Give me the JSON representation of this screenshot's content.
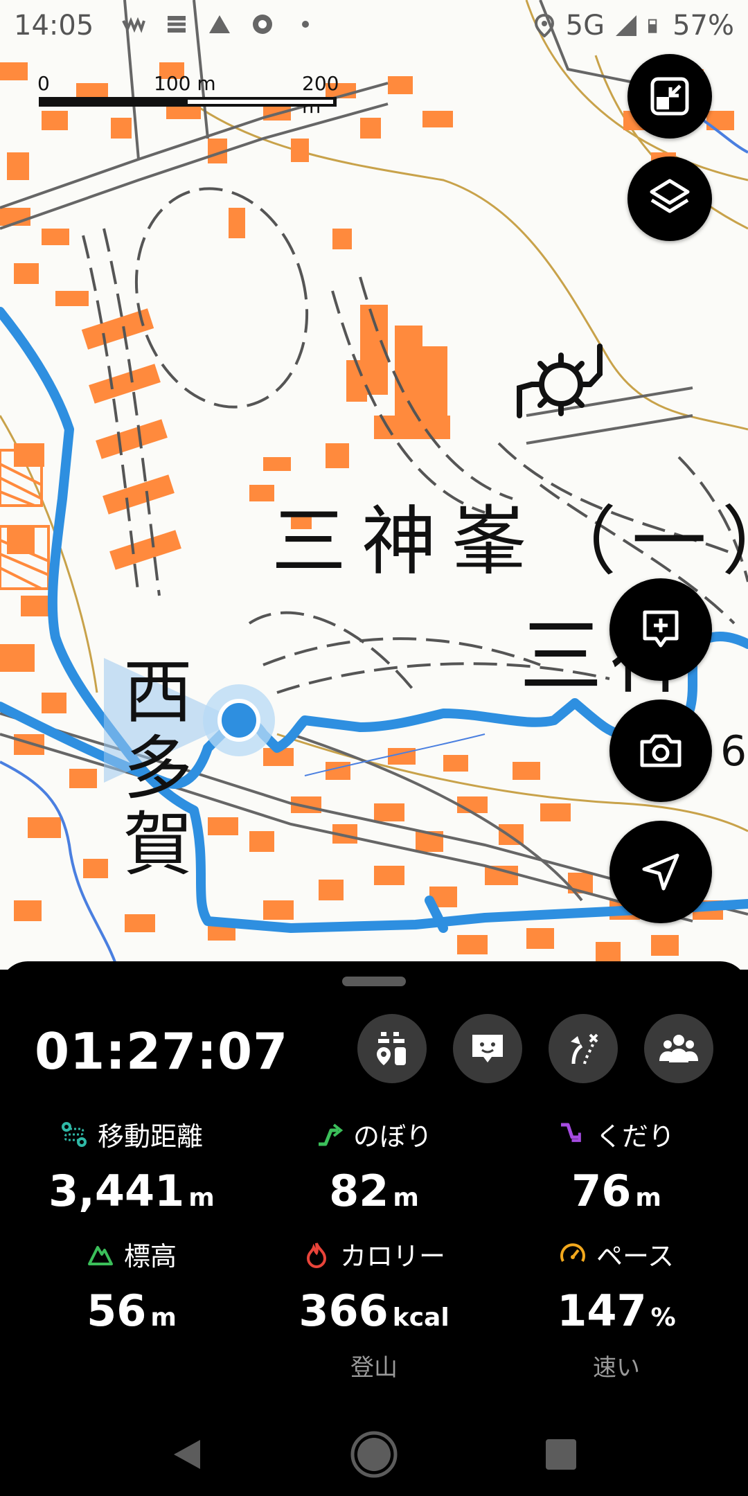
{
  "status_bar": {
    "time": "14:05",
    "network": "5G",
    "battery": "57%",
    "icons": [
      "wave-icon",
      "notes-icon",
      "mountain-icon",
      "chrome-icon",
      "dot-icon",
      "location-icon",
      "signal-icon",
      "battery-icon"
    ]
  },
  "map": {
    "scale": {
      "start": "0",
      "mid": "100 m",
      "end": "200 m"
    },
    "labels": {
      "place_main": "三神峯（一）",
      "place_west": "西多賀",
      "place_partial": "三神",
      "number_partial": "6"
    },
    "colors": {
      "building": "#ff8a3d",
      "track": "#2e8fe0",
      "contour": "#c8a24a",
      "road": "#555555"
    },
    "buttons": [
      "expand-icon",
      "layers-icon",
      "add-note-icon",
      "camera-icon",
      "navigate-icon"
    ]
  },
  "activity": {
    "elapsed": "01:27:07",
    "tools": [
      "checkpoint-icon",
      "chat-icon",
      "route-icon",
      "group-icon"
    ],
    "stats": [
      {
        "key": "distance",
        "label": "移動距離",
        "value": "3,441",
        "unit": "m",
        "icon": "route-icon",
        "color": "#2fb8a6"
      },
      {
        "key": "ascent",
        "label": "のぼり",
        "value": "82",
        "unit": "m",
        "icon": "ascent-icon",
        "color": "#3bbf5a"
      },
      {
        "key": "descent",
        "label": "くだり",
        "value": "76",
        "unit": "m",
        "icon": "descent-icon",
        "color": "#a54be0"
      },
      {
        "key": "elevation",
        "label": "標高",
        "value": "56",
        "unit": "m",
        "icon": "mountain-icon",
        "color": "#3bbf5a"
      },
      {
        "key": "calorie",
        "label": "カロリー",
        "value": "366",
        "unit": "kcal",
        "sub": "登山",
        "icon": "flame-icon",
        "color": "#e8443a"
      },
      {
        "key": "pace",
        "label": "ペース",
        "value": "147",
        "unit": "%",
        "sub": "速い",
        "icon": "speedometer-icon",
        "color": "#f2a81d"
      }
    ]
  },
  "nav_bar": {
    "buttons": [
      "back-icon",
      "home-icon",
      "recents-icon"
    ]
  }
}
